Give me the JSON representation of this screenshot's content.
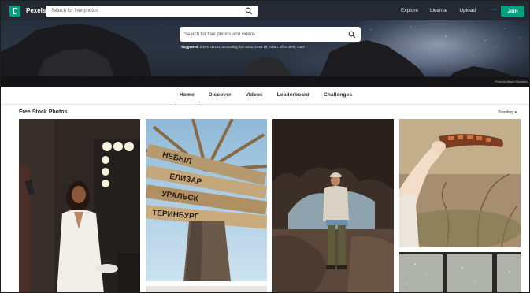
{
  "topnav": {
    "brand": "Pexels",
    "search_placeholder": "Search for free photos",
    "links": [
      "Explore",
      "License",
      "Upload"
    ],
    "more": "···",
    "join": "Join"
  },
  "hero": {
    "search_placeholder": "Search for free photos and videos",
    "suggested_label": "Suggested:",
    "suggested_terms": "breast cancer, accounting, full moon, loved 19, indian, office desk, more",
    "credit": "Photo by Miquel Rossellón"
  },
  "tabs": [
    "Home",
    "Discover",
    "Videos",
    "Leaderboard",
    "Challenges"
  ],
  "active_tab": "Home",
  "section": {
    "title": "Free Stock Photos",
    "sort": "Trending"
  },
  "colors": {
    "accent": "#05a081",
    "nav_bg": "#232a34"
  },
  "photos": {
    "sign_text": [
      "НЕБЫЛ",
      "ЕЛИЗАР",
      "УРАЛЬСК",
      "ТЕРИНБУРГ"
    ]
  }
}
